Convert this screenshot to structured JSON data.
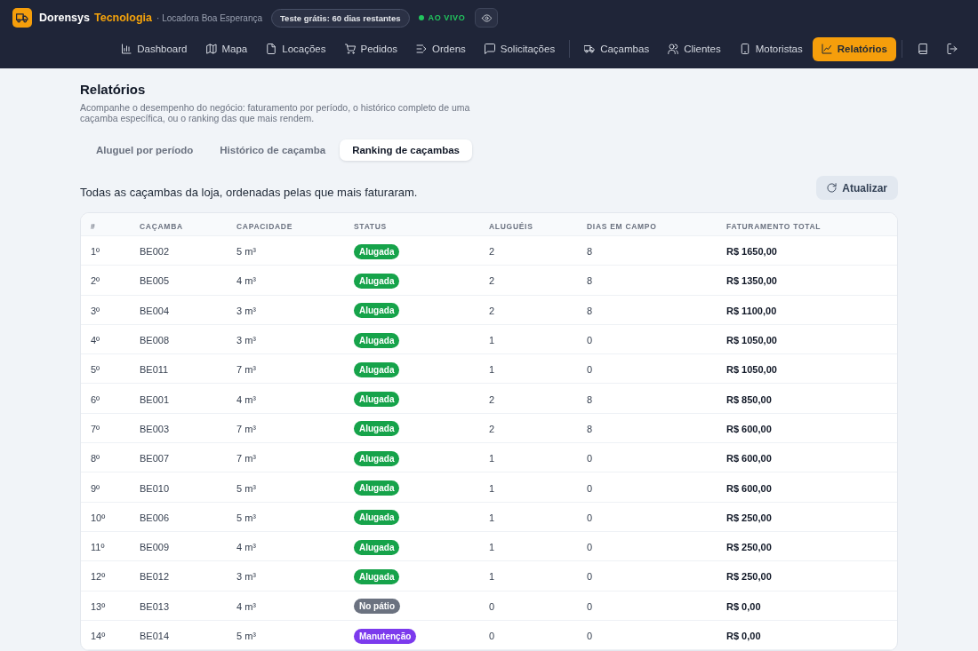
{
  "header": {
    "brand": {
      "name": "Dorensys",
      "accent": "Tecnologia"
    },
    "store": "· Locadora Boa Esperança",
    "trial_badge": "Teste grátis: 60 dias restantes",
    "live": {
      "label": "AO VIVO",
      "on": true
    }
  },
  "nav": {
    "groups": [
      {
        "items": [
          {
            "label": "Dashboard",
            "selected": false
          },
          {
            "label": "Mapa",
            "selected": false
          },
          {
            "label": "Locações",
            "selected": false
          },
          {
            "label": "Pedidos",
            "selected": false
          },
          {
            "label": "Ordens",
            "selected": false
          },
          {
            "label": "Solicitações",
            "selected": false
          }
        ]
      },
      {
        "items": [
          {
            "label": "Caçambas",
            "selected": false
          },
          {
            "label": "Clientes",
            "selected": false
          },
          {
            "label": "Motoristas",
            "selected": false
          },
          {
            "label": "Relatórios",
            "selected": true
          }
        ]
      }
    ]
  },
  "page": {
    "title": "Relatórios",
    "description": "Acompanhe o desempenho do negócio: faturamento por período, o histórico completo de uma caçamba específica, ou o ranking das que mais rendem.",
    "tabs": [
      {
        "label": "Aluguel por período",
        "selected": false
      },
      {
        "label": "Histórico de caçamba",
        "selected": false
      },
      {
        "label": "Ranking de caçambas",
        "selected": true
      }
    ],
    "subtitle": "Todas as caçambas da loja, ordenadas pelas que mais faturaram.",
    "refresh_button": "Atualizar"
  },
  "table": {
    "columns": [
      "#",
      "CAÇAMBA",
      "CAPACIDADE",
      "STATUS",
      "ALUGUÉIS",
      "DIAS EM CAMPO",
      "FATURAMENTO TOTAL"
    ],
    "rows": [
      {
        "rank": "1º",
        "code": "BE002",
        "capacity": "5 m³",
        "status": {
          "label": "Alugada",
          "color": "#16a34a"
        },
        "rentals": "2",
        "days": "8",
        "revenue": "R$ 1650,00"
      },
      {
        "rank": "2º",
        "code": "BE005",
        "capacity": "4 m³",
        "status": {
          "label": "Alugada",
          "color": "#16a34a"
        },
        "rentals": "2",
        "days": "8",
        "revenue": "R$ 1350,00"
      },
      {
        "rank": "3º",
        "code": "BE004",
        "capacity": "3 m³",
        "status": {
          "label": "Alugada",
          "color": "#16a34a"
        },
        "rentals": "2",
        "days": "8",
        "revenue": "R$ 1100,00"
      },
      {
        "rank": "4º",
        "code": "BE008",
        "capacity": "3 m³",
        "status": {
          "label": "Alugada",
          "color": "#16a34a"
        },
        "rentals": "1",
        "days": "0",
        "revenue": "R$ 1050,00"
      },
      {
        "rank": "5º",
        "code": "BE011",
        "capacity": "7 m³",
        "status": {
          "label": "Alugada",
          "color": "#16a34a"
        },
        "rentals": "1",
        "days": "0",
        "revenue": "R$ 1050,00"
      },
      {
        "rank": "6º",
        "code": "BE001",
        "capacity": "4 m³",
        "status": {
          "label": "Alugada",
          "color": "#16a34a"
        },
        "rentals": "2",
        "days": "8",
        "revenue": "R$ 850,00"
      },
      {
        "rank": "7º",
        "code": "BE003",
        "capacity": "7 m³",
        "status": {
          "label": "Alugada",
          "color": "#16a34a"
        },
        "rentals": "2",
        "days": "8",
        "revenue": "R$ 600,00"
      },
      {
        "rank": "8º",
        "code": "BE007",
        "capacity": "7 m³",
        "status": {
          "label": "Alugada",
          "color": "#16a34a"
        },
        "rentals": "1",
        "days": "0",
        "revenue": "R$ 600,00"
      },
      {
        "rank": "9º",
        "code": "BE010",
        "capacity": "5 m³",
        "status": {
          "label": "Alugada",
          "color": "#16a34a"
        },
        "rentals": "1",
        "days": "0",
        "revenue": "R$ 600,00"
      },
      {
        "rank": "10º",
        "code": "BE006",
        "capacity": "5 m³",
        "status": {
          "label": "Alugada",
          "color": "#16a34a"
        },
        "rentals": "1",
        "days": "0",
        "revenue": "R$ 250,00"
      },
      {
        "rank": "11º",
        "code": "BE009",
        "capacity": "4 m³",
        "status": {
          "label": "Alugada",
          "color": "#16a34a"
        },
        "rentals": "1",
        "days": "0",
        "revenue": "R$ 250,00"
      },
      {
        "rank": "12º",
        "code": "BE012",
        "capacity": "3 m³",
        "status": {
          "label": "Alugada",
          "color": "#16a34a"
        },
        "rentals": "1",
        "days": "0",
        "revenue": "R$ 250,00"
      },
      {
        "rank": "13º",
        "code": "BE013",
        "capacity": "4 m³",
        "status": {
          "label": "No pátio",
          "color": "#6b7280"
        },
        "rentals": "0",
        "days": "0",
        "revenue": "R$ 0,00"
      },
      {
        "rank": "14º",
        "code": "BE014",
        "capacity": "5 m³",
        "status": {
          "label": "Manutenção",
          "color": "#7c3aed"
        },
        "rentals": "0",
        "days": "0",
        "revenue": "R$ 0,00"
      }
    ]
  }
}
